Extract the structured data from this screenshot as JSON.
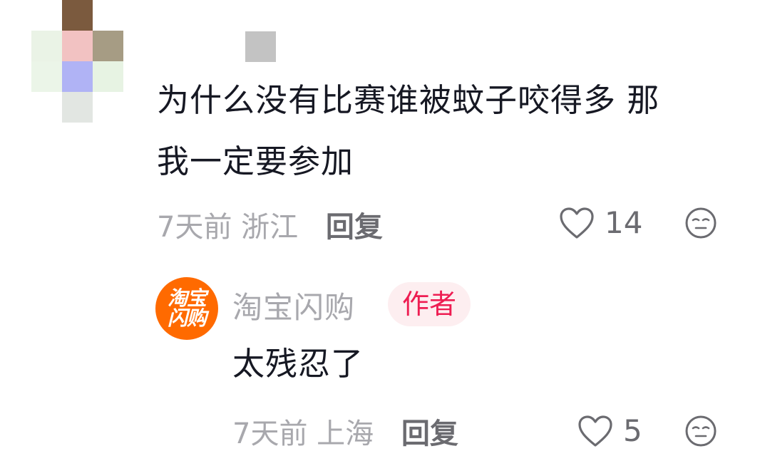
{
  "comment": {
    "lines": [
      "为什么没有比赛谁被蚊子咬得多 那",
      "我一定要参加"
    ],
    "time": "7天前",
    "location": "浙江",
    "reply_label": "回复",
    "likes": "14"
  },
  "reply": {
    "logo_lines": [
      "淘宝",
      "闪购"
    ],
    "username": "淘宝闪购",
    "badge": "作者",
    "text": "太残忍了",
    "time": "7天前",
    "location": "上海",
    "reply_label": "回复",
    "likes": "5"
  },
  "icons": {
    "like": "heart-outline-icon",
    "dislike": "neutral-face-icon",
    "logo_color": "#ff6a00",
    "badge_color": "#ee1d52"
  }
}
